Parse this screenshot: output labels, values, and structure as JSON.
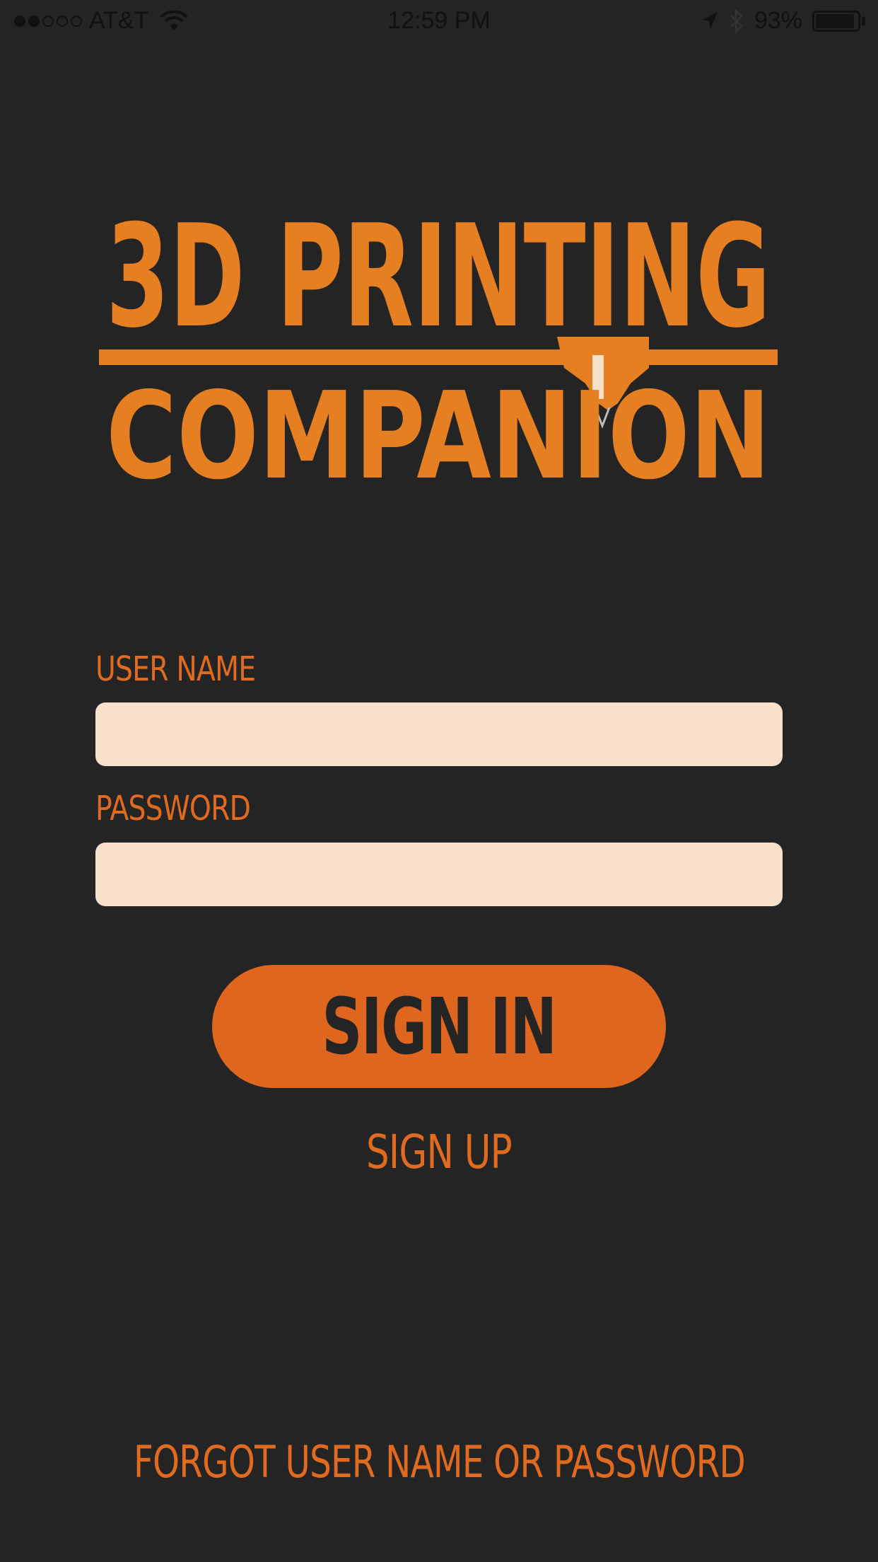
{
  "status_bar": {
    "carrier": "AT&T",
    "time": "12:59 PM",
    "battery_percent": "93%",
    "battery_level": 0.93,
    "signal_bars_filled": 2,
    "signal_bars_total": 5
  },
  "logo": {
    "line1": "3D PRINTING",
    "line2": "COMPANION",
    "color": "#e67e22"
  },
  "form": {
    "username_label": "USER NAME",
    "username_value": "",
    "password_label": "PASSWORD",
    "password_value": ""
  },
  "actions": {
    "sign_in": "SIGN IN",
    "sign_up": "SIGN UP",
    "forgot": "FORGOT USER NAME OR PASSWORD"
  },
  "colors": {
    "background": "#242424",
    "accent": "#de661e",
    "field_bg": "#f9e0ca"
  }
}
